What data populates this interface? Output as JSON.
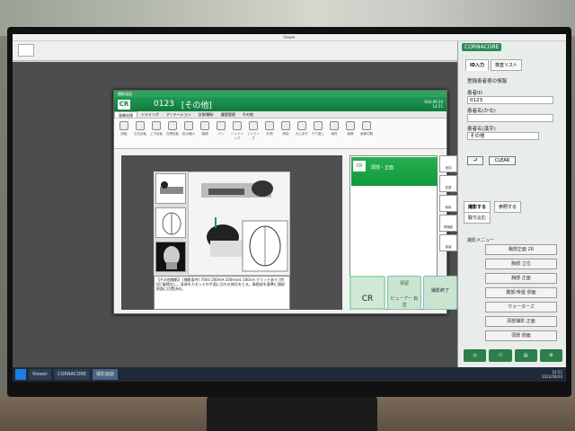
{
  "viewer": {
    "title": "Viewer"
  },
  "dialog": {
    "title": "撮影画面",
    "logo": "CR",
    "patient_id": "0123",
    "patient_name": "[その他]",
    "date": "R04.09.20",
    "time": "14:51",
    "ribbon_tabs": [
      "画像処理",
      "トリミング",
      "アノテーション",
      "計測/解析",
      "履歴管理",
      "その他"
    ],
    "tools": [
      "回転",
      "左右反転",
      "上下反転",
      "白黒反転",
      "拡大縮小",
      "階調",
      "パン",
      "ハンドリング",
      "トリミング",
      "計測",
      "削除",
      "元に戻す",
      "やり直し",
      "画質",
      "画像",
      "画像切替"
    ],
    "notes": "【その他撮影】 [撮影条件] 70kV 200mA 100msec 100cm グリッドあり [特記] 破損なし。身体をカセッテの平面に沿わせ体位をとる。鼻根部を基準に頭部前面に位置決め。",
    "series_title": "頭部・正面",
    "right_tools": [
      "追加",
      "変更",
      "削除",
      "再撮影",
      "保留"
    ],
    "btn_view": "ビューアー 転送",
    "btn_done": "撮影終了",
    "btn_cr": "CR",
    "btn_hold": "保留"
  },
  "side": {
    "logo": "CORNACORE",
    "tabs": [
      "ID入力",
      "検査リスト"
    ],
    "section": "登録患者様の情報",
    "id_label": "患者ID",
    "id_value": "0123",
    "name_label": "患者名(かな)",
    "name_label2": "患者名(漢字)",
    "sex_label": "性別",
    "sex_value": "その他",
    "clear": "CLEAR",
    "menu_tabs": [
      "撮影する",
      "参照する",
      "取り込む"
    ],
    "menu_title": "撮影メニュー",
    "menu_items": [
      "胸部正面 2R",
      "胸部 立位",
      "胸部 正面",
      "腹部/骨盤 側面",
      "ウォーターズ",
      "頭部撮影 正面",
      "頭部 側面"
    ],
    "other_menu": "その他の撮影メニュー"
  },
  "taskbar": {
    "items": [
      "Viewer",
      "CORNACORE",
      "撮影画面"
    ],
    "clock_time": "14:51",
    "clock_date": "2022/09/20"
  }
}
